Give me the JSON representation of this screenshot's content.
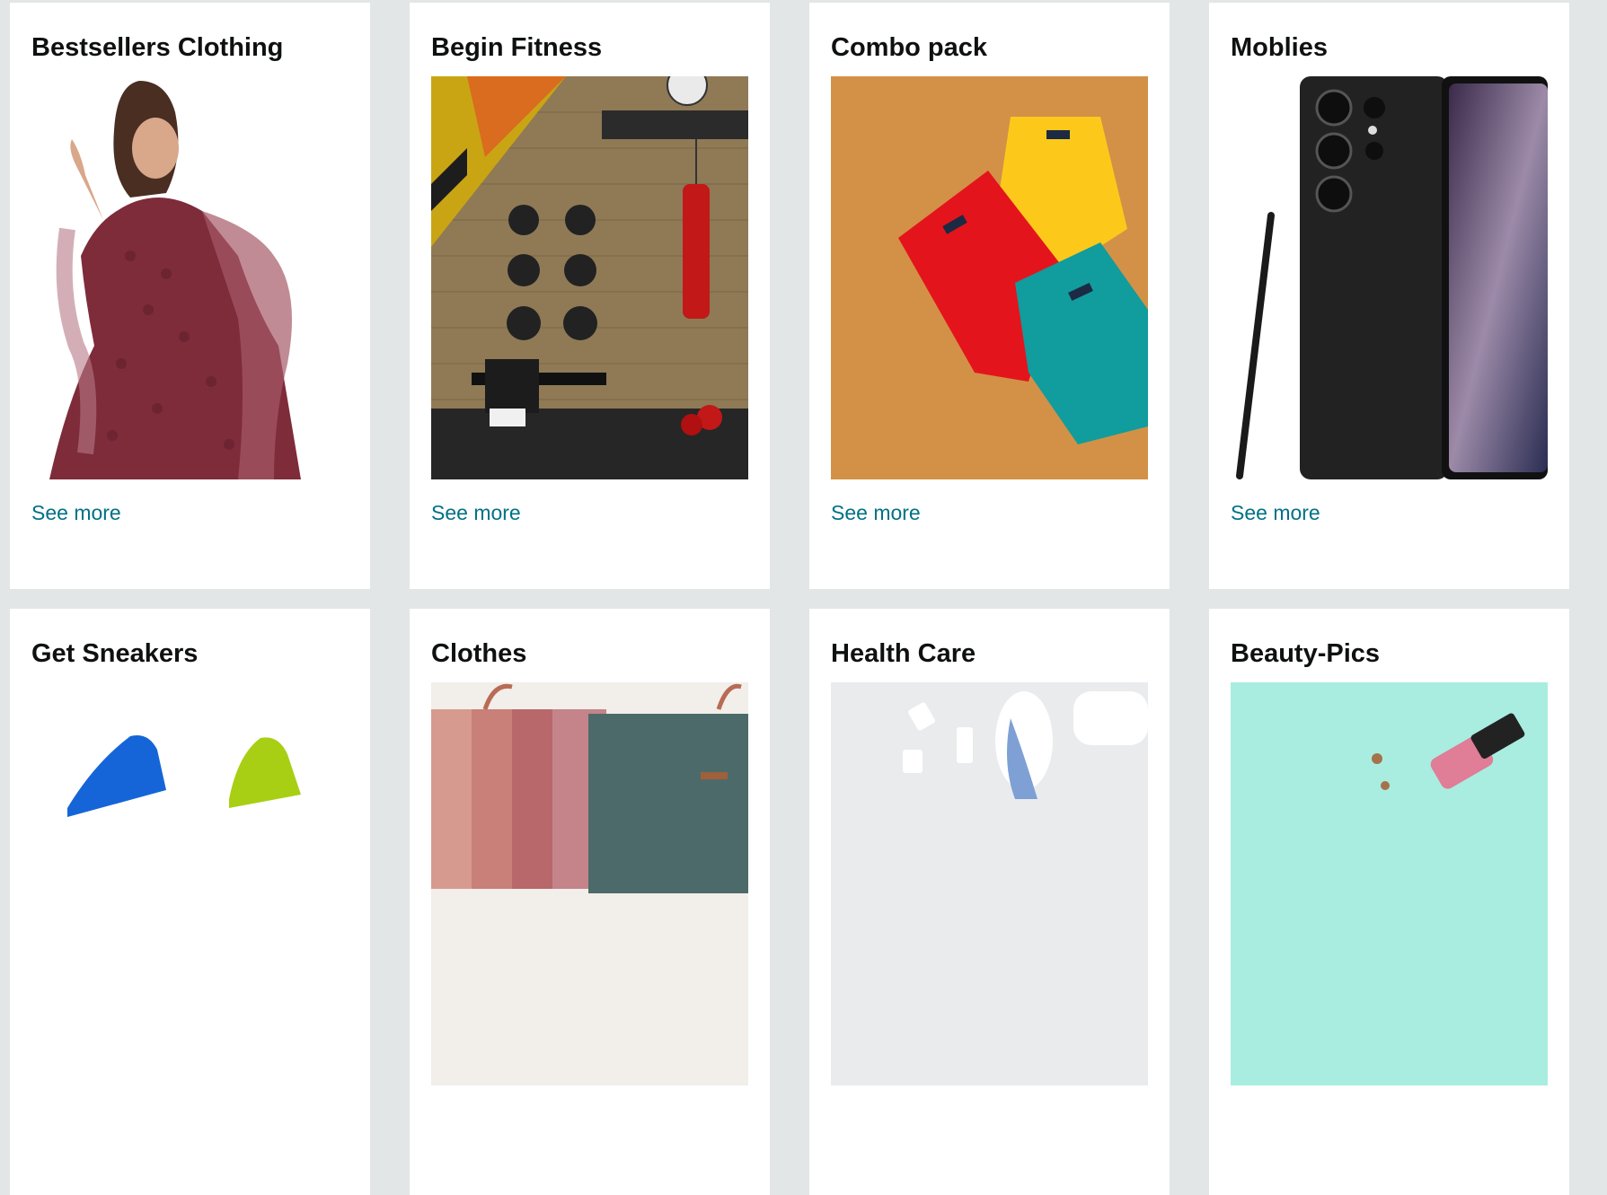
{
  "cards": [
    {
      "title": "Bestsellers Clothing",
      "link": "See more",
      "image": "woman-dress-photo"
    },
    {
      "title": "Begin Fitness",
      "link": "See more",
      "image": "home-gym-photo"
    },
    {
      "title": "Combo pack",
      "link": "See more",
      "image": "tshirts-combo-photo"
    },
    {
      "title": "Moblies",
      "link": "See more",
      "image": "smartphone-photo"
    },
    {
      "title": "Get Sneakers",
      "link": "",
      "image": "sneakers-photo"
    },
    {
      "title": "Clothes",
      "link": "",
      "image": "folded-clothes-photo"
    },
    {
      "title": "Health Care",
      "link": "",
      "image": "health-care-photo"
    },
    {
      "title": "Beauty-Pics",
      "link": "",
      "image": "beauty-products-photo"
    }
  ],
  "colors": {
    "page_background": "#e3e6e6",
    "card_background": "#ffffff",
    "link": "#007185",
    "title": "#0f1111"
  }
}
